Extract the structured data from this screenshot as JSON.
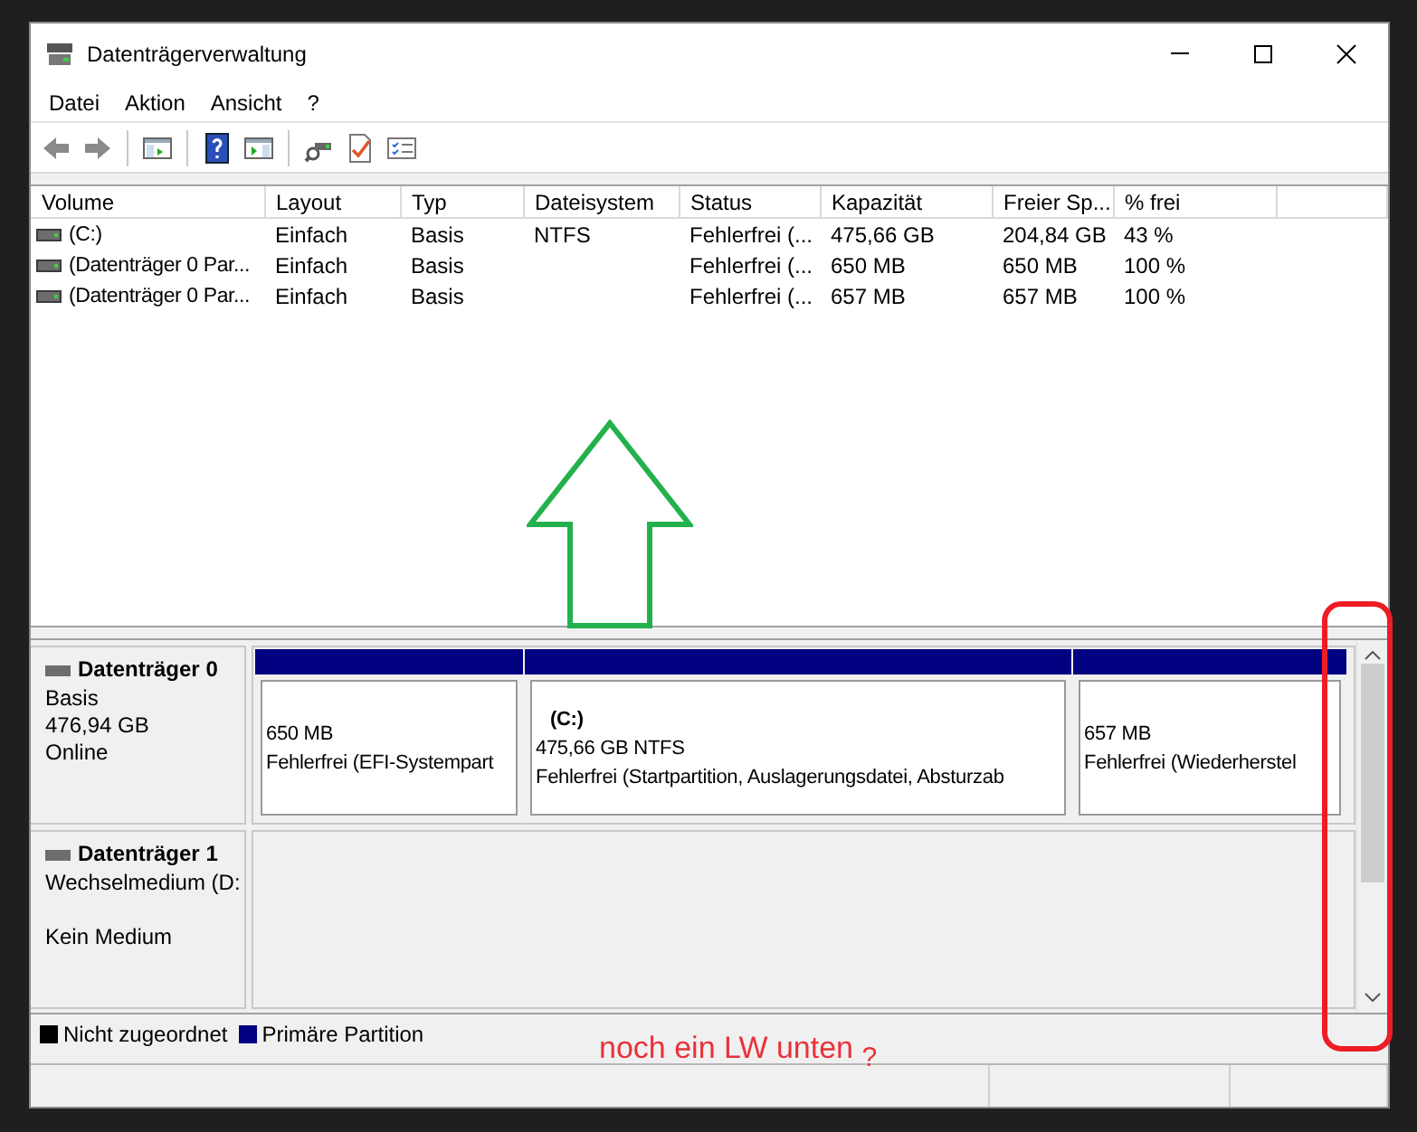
{
  "window": {
    "title": "Datenträgerverwaltung"
  },
  "menu": [
    {
      "label": "Datei"
    },
    {
      "label": "Aktion"
    },
    {
      "label": "Ansicht"
    },
    {
      "label": "?"
    }
  ],
  "volume_table": {
    "columns": [
      "Volume",
      "Layout",
      "Typ",
      "Dateisystem",
      "Status",
      "Kapazität",
      "Freier Sp...",
      "% frei"
    ],
    "rows": [
      [
        "(C:)",
        "Einfach",
        "Basis",
        "NTFS",
        "Fehlerfrei (...",
        "475,66 GB",
        "204,84 GB",
        "43 %"
      ],
      [
        "(Datenträger 0 Par...",
        "Einfach",
        "Basis",
        "",
        "Fehlerfrei (...",
        "650 MB",
        "650 MB",
        "100 %"
      ],
      [
        "(Datenträger 0 Par...",
        "Einfach",
        "Basis",
        "",
        "Fehlerfrei (...",
        "657 MB",
        "657 MB",
        "100 %"
      ]
    ]
  },
  "disks": [
    {
      "name": "Datenträger 0",
      "type": "Basis",
      "size": "476,94 GB",
      "state": "Online",
      "partitions": [
        {
          "size": "650 MB",
          "status": "Fehlerfrei (EFI-Systempart",
          "color": "#000080"
        },
        {
          "title": "(C:)",
          "size": "475,66 GB NTFS",
          "status": "Fehlerfrei (Startpartition, Auslagerungsdatei, Absturzab",
          "color": "#000080"
        },
        {
          "size": "657 MB",
          "status": "Fehlerfrei (Wiederherstel",
          "color": "#000080"
        }
      ]
    },
    {
      "name": "Datenträger 1",
      "type": "Wechselmedium (D:",
      "state": "Kein Medium"
    }
  ],
  "legend": [
    {
      "label": "Nicht zugeordnet",
      "color": "#000000"
    },
    {
      "label": "Primäre Partition",
      "color": "#000080"
    }
  ],
  "annotations": [
    {
      "kind": "arrow"
    },
    {
      "kind": "frame"
    },
    {
      "kind": "note",
      "text": "noch ein LW unten $_{?}$"
    }
  ]
}
